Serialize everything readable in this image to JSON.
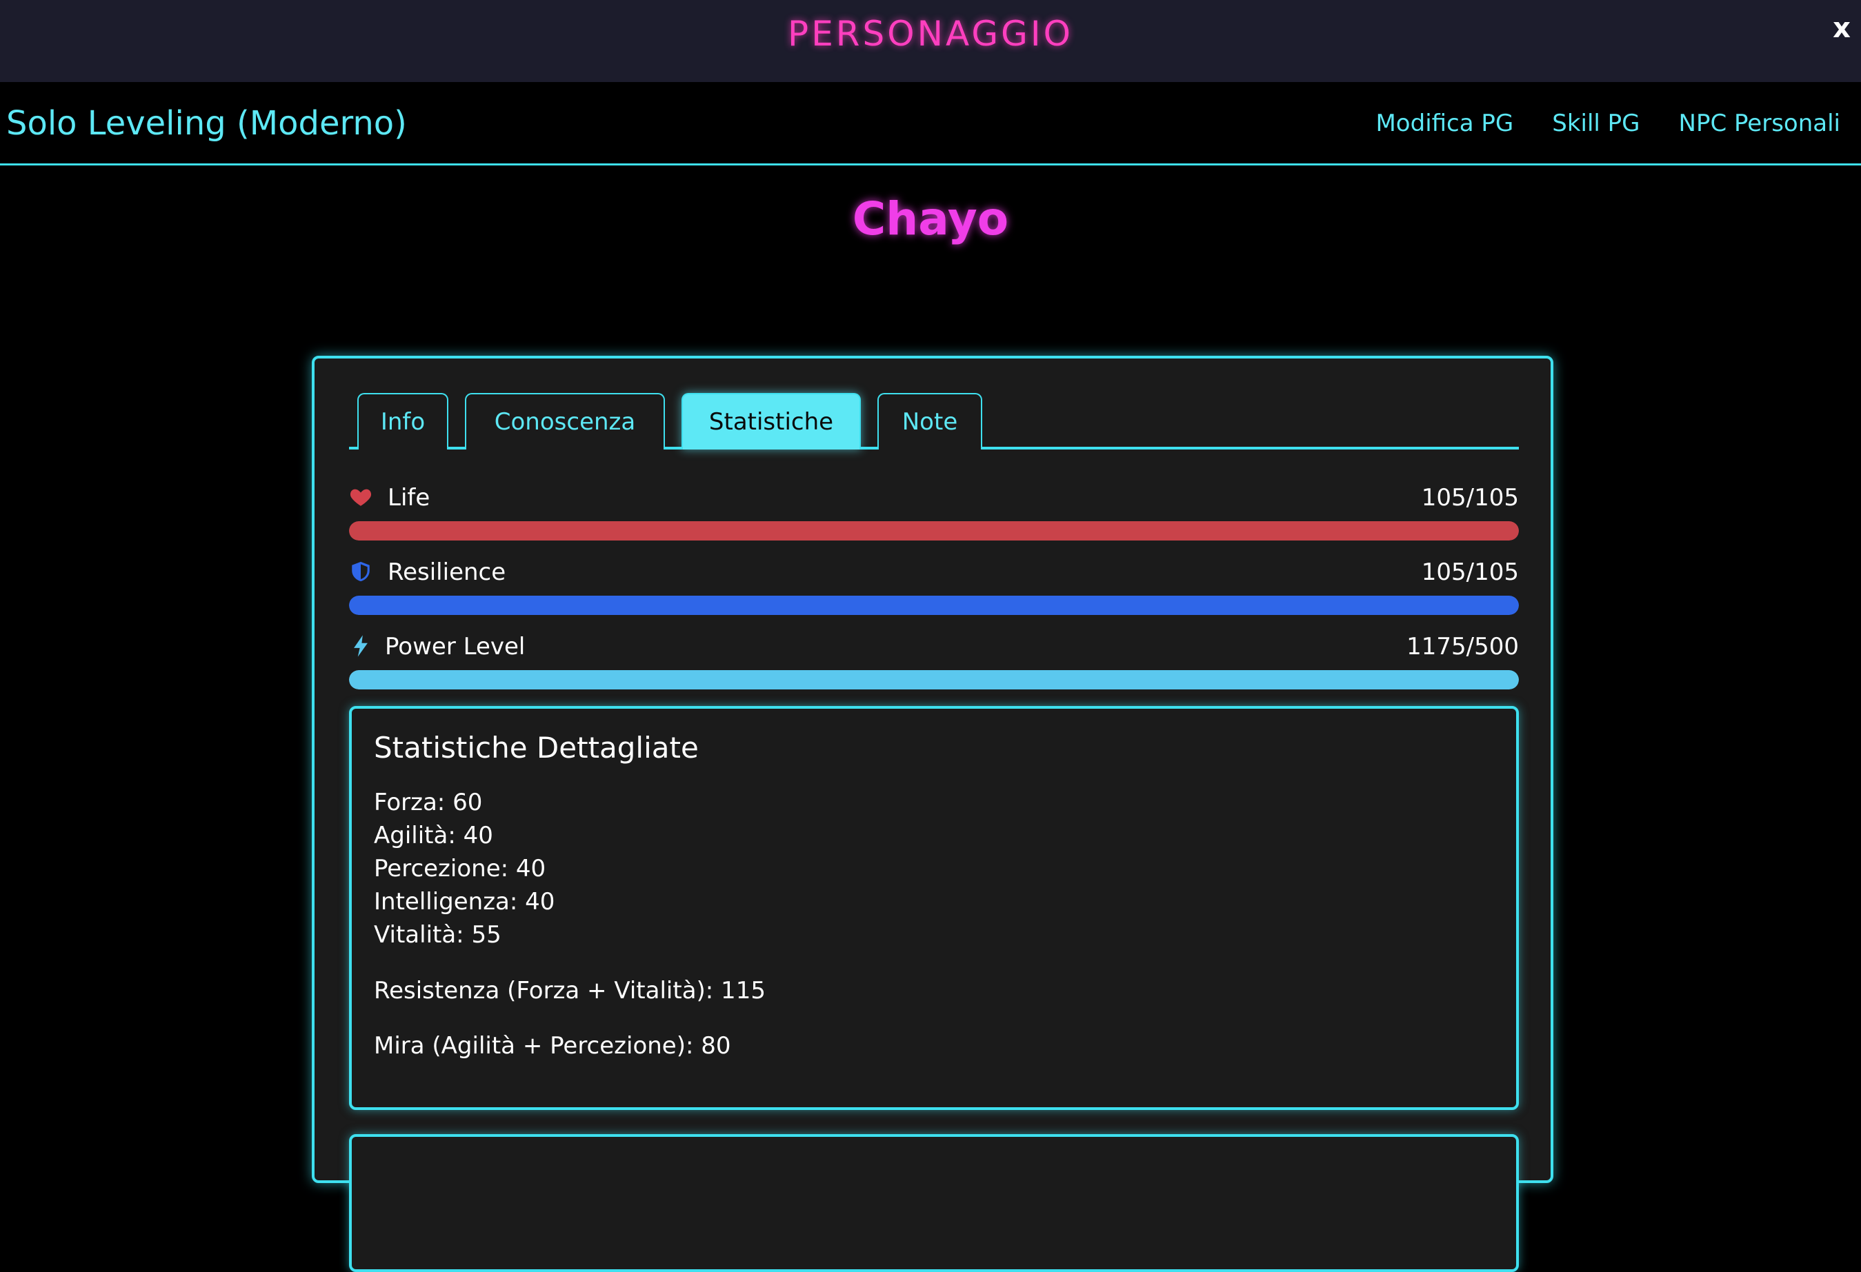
{
  "window": {
    "title": "PERSONAGGIO",
    "close_label": "x"
  },
  "nav": {
    "brand": "Solo Leveling (Moderno)",
    "links": [
      "Modifica PG",
      "Skill PG",
      "NPC Personali"
    ]
  },
  "character": {
    "name": "Chayo"
  },
  "tabs": [
    {
      "label": "Info",
      "active": false
    },
    {
      "label": "Conoscenza",
      "active": false
    },
    {
      "label": "Statistiche",
      "active": true
    },
    {
      "label": "Note",
      "active": false
    }
  ],
  "stats": [
    {
      "label": "Life",
      "value_text": "105/105",
      "fill_fraction": 1.0,
      "color": "#c9434a",
      "icon": "heart-icon"
    },
    {
      "label": "Resilience",
      "value_text": "105/105",
      "fill_fraction": 1.0,
      "color": "#2f66e8",
      "icon": "shield-icon"
    },
    {
      "label": "Power Level",
      "value_text": "1175/500",
      "fill_fraction": 1.0,
      "color": "#5bc8ee",
      "icon": "lightning-icon"
    }
  ],
  "details": {
    "title": "Statistiche Dettagliate",
    "lines": [
      "Forza: 60",
      "Agilità: 40",
      "Percezione: 40",
      "Intelligenza: 40",
      "Vitalità: 55"
    ],
    "resistenza": "Resistenza (Forza + Vitalità): 115",
    "mira": "Mira (Agilità + Percezione): 80"
  },
  "colors": {
    "accent_cyan": "#3ee0ef",
    "accent_magenta": "#ff3fbf",
    "name_magenta": "#f03ee8"
  }
}
